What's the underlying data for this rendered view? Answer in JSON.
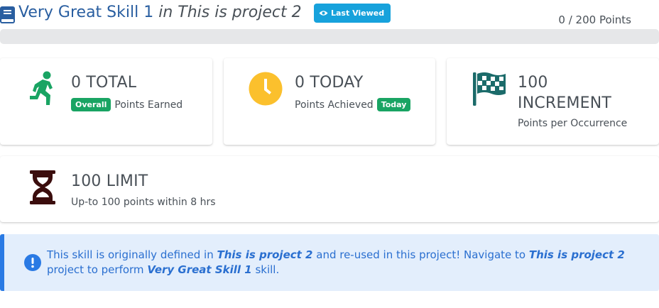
{
  "header": {
    "skill_name": "Very Great Skill 1",
    "in_project": "in This is project 2",
    "last_viewed_label": "Last Viewed",
    "points_progress": "0 / 200 Points",
    "progress_fraction": 0
  },
  "cards": {
    "total": {
      "value": "0 TOTAL",
      "badge": "Overall",
      "label": "Points Earned",
      "icon": "running-person-icon"
    },
    "today": {
      "value": "0 TODAY",
      "label": "Points Achieved",
      "badge": "Today",
      "icon": "clock-icon"
    },
    "increment": {
      "value_line1": "100",
      "value_line2": "INCREMENT",
      "label": "Points per Occurrence",
      "icon": "checkered-flag-icon"
    },
    "limit": {
      "value": "100 LIMIT",
      "label": "Up-to 100 points within 8 hrs",
      "icon": "hourglass-icon"
    }
  },
  "alert": {
    "t1": "This skill is originally defined in ",
    "project_a": "This is project 2",
    "t2": " and re-used in this project! Navigate to ",
    "project_b": "This is project 2",
    "t3": " project to perform ",
    "skill": "Very Great Skill 1",
    "t4": " skill."
  },
  "colors": {
    "title_blue": "#295ea0",
    "badge_blue": "#17a2dc",
    "green": "#19a463",
    "clock_yellow": "#fbc02d",
    "flag_teal": "#1b6b6a",
    "hourglass_dark": "#3b0d0d",
    "alert_bg": "#e3eefc",
    "alert_text": "#2a6fd0"
  }
}
